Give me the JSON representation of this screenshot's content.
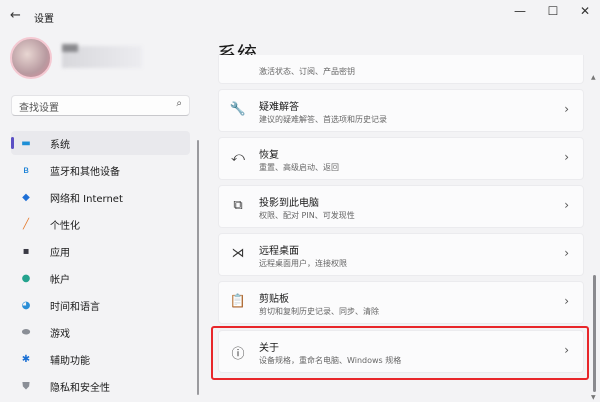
{
  "window": {
    "title": "设置",
    "back": "←",
    "minimize": "—",
    "maximize": "☐",
    "close": "✕"
  },
  "search": {
    "placeholder": "查找设置",
    "icon": "⌕"
  },
  "sidebar": {
    "items": [
      {
        "label": "系统",
        "icon": "▬",
        "color": "#1e8fd6"
      },
      {
        "label": "蓝牙和其他设备",
        "icon": "ʙ",
        "color": "#0a78d4"
      },
      {
        "label": "网络和 Internet",
        "icon": "◆",
        "color": "#1e6fd6"
      },
      {
        "label": "个性化",
        "icon": "╱",
        "color": "#e5792a"
      },
      {
        "label": "应用",
        "icon": "▪",
        "color": "#3a3a44"
      },
      {
        "label": "帐户",
        "icon": "●",
        "color": "#24a38e"
      },
      {
        "label": "时间和语言",
        "icon": "◕",
        "color": "#2a8ed6"
      },
      {
        "label": "游戏",
        "icon": "⬬",
        "color": "#8a8e96"
      },
      {
        "label": "辅助功能",
        "icon": "✱",
        "color": "#1a6fd4"
      },
      {
        "label": "隐私和安全性",
        "icon": "⛊",
        "color": "#8a8e96"
      }
    ]
  },
  "main": {
    "title": "系统",
    "cards": [
      {
        "title": "",
        "subtitle": "激活状态、订阅、产品密钥",
        "icon": ""
      },
      {
        "title": "疑难解答",
        "subtitle": "建议的疑难解答、首选项和历史记录",
        "icon": "🔧"
      },
      {
        "title": "恢复",
        "subtitle": "重置、高级启动、返回",
        "icon": "⤺"
      },
      {
        "title": "投影到此电脑",
        "subtitle": "权限、配对 PIN、可发现性",
        "icon": "⧉"
      },
      {
        "title": "远程桌面",
        "subtitle": "远程桌面用户，连接权限",
        "icon": "⋊"
      },
      {
        "title": "剪贴板",
        "subtitle": "剪切和复制历史记录、同步、清除",
        "icon": "📋"
      },
      {
        "title": "关于",
        "subtitle": "设备规格，重命名电脑、Windows 规格",
        "icon": "ⓘ"
      }
    ],
    "chevron": "›"
  },
  "highlight_color": "#e8262a"
}
